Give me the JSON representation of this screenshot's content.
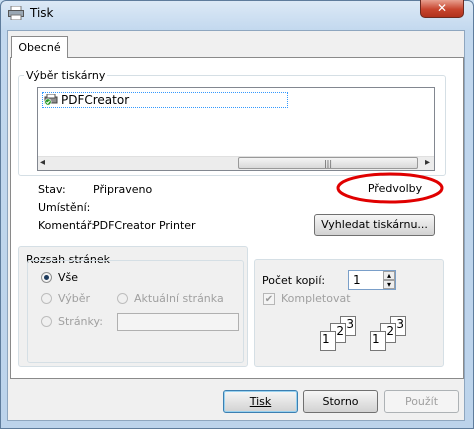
{
  "window": {
    "title": "Tisk",
    "close_glyph": "✕"
  },
  "tabs": [
    {
      "label": "Obecné"
    }
  ],
  "printer_group": {
    "legend": "Výběr tiskárny",
    "printers": [
      {
        "name": "PDFCreator",
        "selected": true
      }
    ],
    "scroll_left": "◂",
    "scroll_right": "▸",
    "scroll_grip": "|||"
  },
  "status": {
    "stav_label": "Stav:",
    "stav_value": "Připraveno",
    "umisteni_label": "Umístění:",
    "umisteni_value": "",
    "komentar_label": "Komentář:",
    "komentar_value": "PDFCreator Printer"
  },
  "buttons": {
    "preferences": "Předvolby",
    "find_printer": "Vyhledat tiskárnu...",
    "print": "Tisk",
    "cancel": "Storno",
    "apply": "Použít"
  },
  "page_range": {
    "legend": "Rozsah stránek",
    "all": "Vše",
    "selection": "Výběr",
    "current_page": "Aktuální stránka",
    "pages": "Stránky:",
    "pages_value": ""
  },
  "copies": {
    "label": "Počet kopií:",
    "value": "1",
    "collate": "Kompletovat",
    "collate_checked": true,
    "spin_up": "▴",
    "spin_down": "▾",
    "collate_digits": [
      "1",
      "2",
      "3",
      "1",
      "2",
      "3"
    ]
  },
  "colors": {
    "highlight_circle": "#e00000",
    "accent": "#3399ff"
  }
}
